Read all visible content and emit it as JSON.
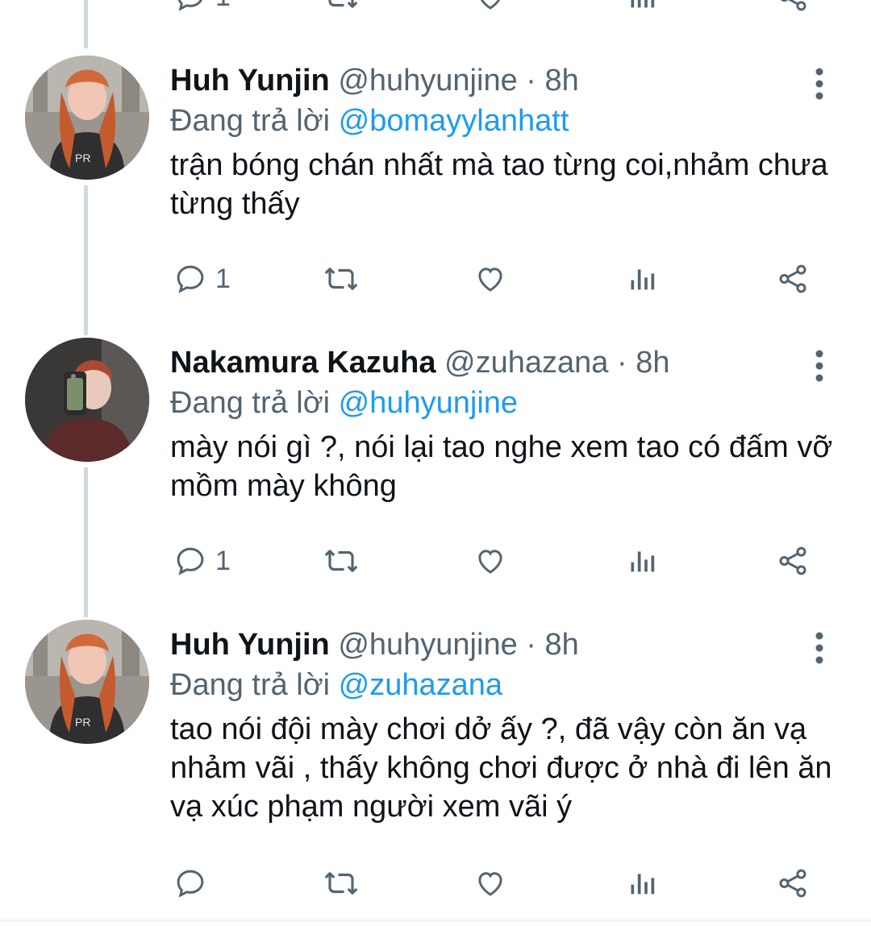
{
  "tweets": [
    {
      "name": "Huh Yunjin",
      "handle": "@huhyunjine",
      "separator": "·",
      "time": "8h",
      "replying_prefix": "Đang trả lời",
      "replying_to": "@bomayylanhatt",
      "text": "trận bóng chán nhất mà tao từng coi,nhảm chưa từng thấy",
      "reply_count": "1"
    },
    {
      "name": "Nakamura Kazuha",
      "handle": "@zuhazana",
      "separator": "·",
      "time": "8h",
      "replying_prefix": "Đang trả lời",
      "replying_to": "@huhyunjine",
      "text": "mày nói gì ?, nói lại tao nghe xem tao có đấm vỡ mồm mày không",
      "reply_count": "1"
    },
    {
      "name": "Huh Yunjin",
      "handle": "@huhyunjine",
      "separator": "·",
      "time": "8h",
      "replying_prefix": "Đang trả lời",
      "replying_to": "@zuhazana",
      "text": "tao nói đội mày chơi dở ấy ?, đã vậy còn ăn vạ nhảm vãi , thấy không chơi được ở nhà đi lên ăn vạ xúc phạm người xem vãi ý",
      "reply_count": ""
    }
  ],
  "top_actions": {
    "reply_count": "1"
  },
  "icons": [
    "reply-icon",
    "retweet-icon",
    "like-icon",
    "analytics-icon",
    "share-icon",
    "more-options-icon"
  ],
  "colors": {
    "text": "#0f1419",
    "secondary": "#536471",
    "link": "#1d9bf0",
    "thread_line": "#cfd9de"
  }
}
